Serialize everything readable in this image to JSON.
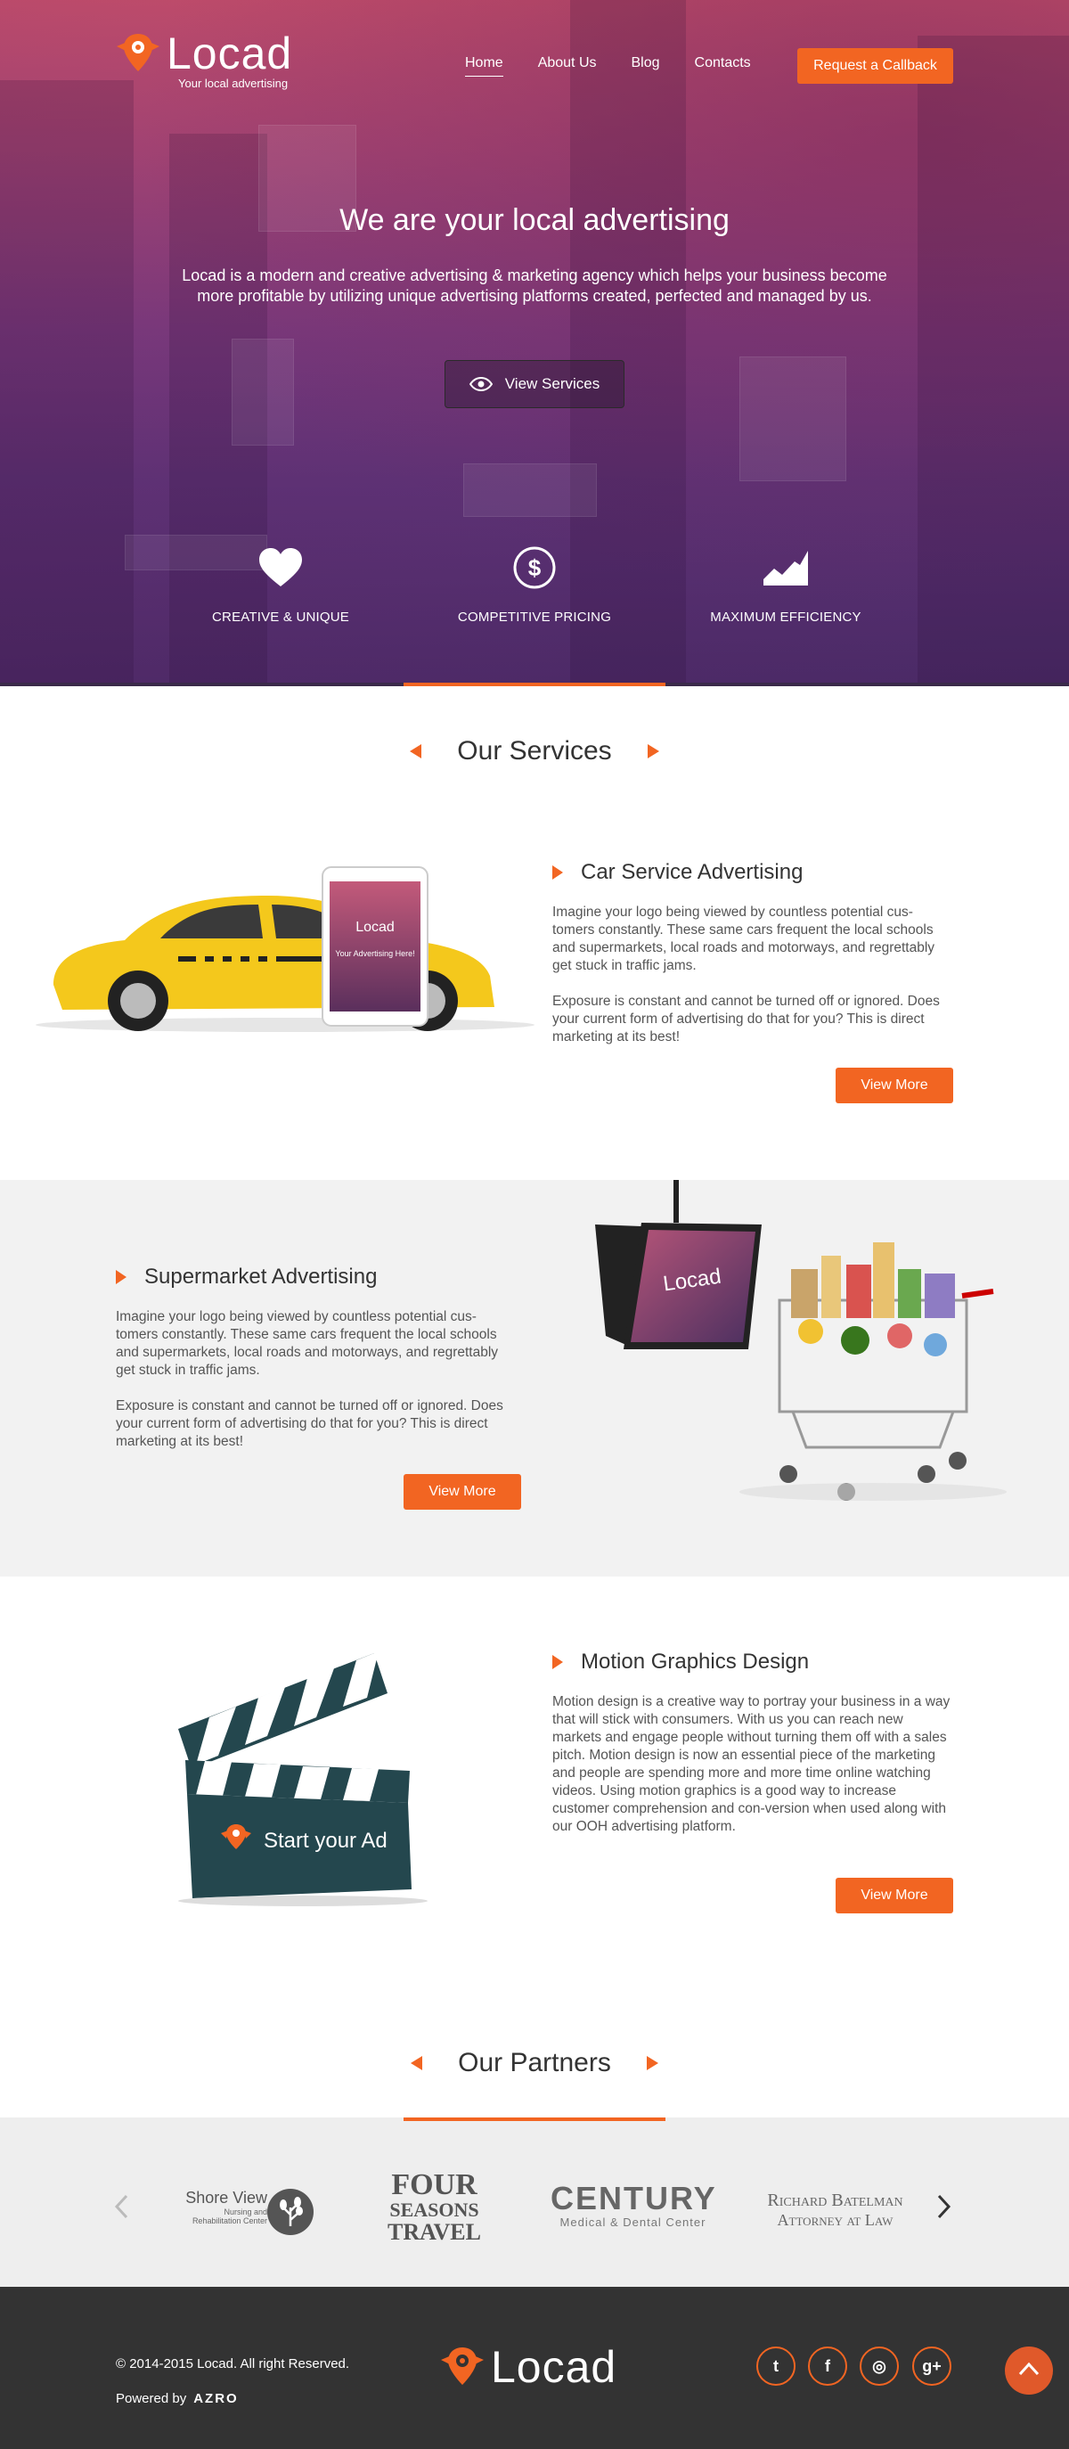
{
  "brand": {
    "name": "Locad",
    "tagline": "Your local advertising",
    "accent": "#f26522"
  },
  "nav": {
    "items": [
      "Home",
      "About Us",
      "Blog",
      "Contacts"
    ],
    "active": "Home",
    "callback": "Request a Callback"
  },
  "hero": {
    "title": "We are your local advertising",
    "description": "Locad is a modern and creative advertising & marketing agency which helps your business become more profitable by utilizing unique advertising platforms created, perfected and managed by us.",
    "button": "View Services",
    "features": [
      {
        "icon": "heart-icon",
        "label": "CREATIVE & UNIQUE"
      },
      {
        "icon": "dollar-icon",
        "label": "COMPETITIVE PRICING"
      },
      {
        "icon": "chart-icon",
        "label": "MAXIMUM EFFICIENCY"
      }
    ]
  },
  "services": {
    "heading": "Our Services",
    "items": [
      {
        "title": "Car Service Advertising",
        "p1": "Imagine your logo being viewed by countless potential cus-tomers constantly. These same cars frequent the local schools and supermarkets, local roads and motorways, and regrettably get stuck in traffic jams.",
        "p2": "Exposure is constant and cannot be turned off or ignored. Does your current form of advertising do that for you? This is direct marketing at its best!",
        "button": "View More",
        "image_text": "Your Advertising Here!"
      },
      {
        "title": "Supermarket Advertising",
        "p1": "Imagine your logo being viewed by countless potential cus-tomers constantly. These same cars frequent the local schools and supermarkets, local roads and motorways, and regrettably get stuck in traffic jams.",
        "p2": "Exposure is constant and cannot be turned off or ignored. Does your current form of advertising do that for you? This is direct marketing at its best!",
        "button": "View More"
      },
      {
        "title": "Motion Graphics Design",
        "p1": "Motion design is a creative way to portray your business in a way that will stick with consumers. With us you can reach new markets and engage people without turning them off with a sales pitch. Motion design is now an essential piece of the marketing and people are spending more and more time online watching videos. Using motion graphics is a good way to increase customer comprehension and con-version when used along with our OOH advertising platform.",
        "button": "View More",
        "image_text": "Start your Ad"
      }
    ]
  },
  "partners": {
    "heading": "Our Partners",
    "items": [
      {
        "line1": "Shore View",
        "line2": "Nursing and",
        "line3": "Rehabilitation Center"
      },
      {
        "line1": "FOUR",
        "line2": "SEASONS",
        "line3": "TRAVEL"
      },
      {
        "line1": "CENTURY",
        "line2": "Medical & Dental Center"
      },
      {
        "line1": "Richard Batelman",
        "line2": "Attorney at Law"
      }
    ]
  },
  "footer": {
    "copyright": "© 2014-2015 Locad. All right Reserved.",
    "powered": "Powered by",
    "powered_brand": "AZRO",
    "social": [
      {
        "icon": "twitter-icon",
        "glyph": "t"
      },
      {
        "icon": "facebook-icon",
        "glyph": "f"
      },
      {
        "icon": "instagram-icon",
        "glyph": "◎"
      },
      {
        "icon": "google-plus-icon",
        "glyph": "g+"
      }
    ]
  }
}
